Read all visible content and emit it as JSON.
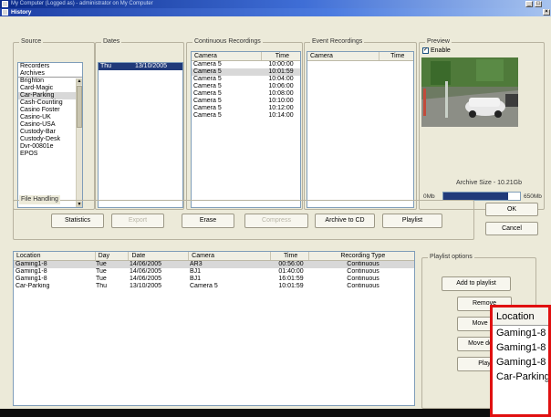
{
  "window": {
    "outer_title": "My Computer (Logged as) - administrator on My Computer",
    "title": "History",
    "controls": [
      "_",
      "□",
      "×"
    ]
  },
  "source": {
    "label": "Source",
    "top_items": [
      "Recorders",
      "Archives"
    ],
    "items": [
      "Brighton",
      "Card-Magic",
      "Car-Parking",
      "Cash-Counting",
      "Casino Foster",
      "Casino-UK",
      "Casino-USA",
      "Custody-Bar",
      "Custody-Desk",
      "Dvr-00801e",
      "EPOS"
    ],
    "selected": "Car-Parking"
  },
  "dates": {
    "label": "Dates",
    "rows": [
      {
        "day": "Thu",
        "date": "13/10/2005"
      }
    ]
  },
  "continuous": {
    "label": "Continuous Recordings",
    "columns": [
      "Camera",
      "Time"
    ],
    "rows": [
      {
        "camera": "Camera 5",
        "time": "10:00:00"
      },
      {
        "camera": "Camera 5",
        "time": "10:01:59"
      },
      {
        "camera": "Camera 5",
        "time": "10:04:00"
      },
      {
        "camera": "Camera 5",
        "time": "10:06:00"
      },
      {
        "camera": "Camera 5",
        "time": "10:08:00"
      },
      {
        "camera": "Camera 5",
        "time": "10:10:00"
      },
      {
        "camera": "Camera 5",
        "time": "10:12:00"
      },
      {
        "camera": "Camera 5",
        "time": "10:14:00"
      }
    ]
  },
  "event": {
    "label": "Event Recordings",
    "columns": [
      "Camera",
      "Time"
    ]
  },
  "preview": {
    "label": "Preview",
    "enable_label": "Enable",
    "enabled": true,
    "archive_size": "Archive Size - 10.21Gb",
    "min_label": "0Mb",
    "max_label": "650Mb",
    "fill_percent": 85
  },
  "file_handling": {
    "label": "File Handling",
    "buttons": [
      {
        "label": "Statistics",
        "enabled": true
      },
      {
        "label": "Export",
        "enabled": false
      },
      {
        "label": "Erase",
        "enabled": true
      },
      {
        "label": "Compress",
        "enabled": false
      },
      {
        "label": "Archive to CD",
        "enabled": true
      },
      {
        "label": "Playlist",
        "enabled": true
      }
    ]
  },
  "dialog": {
    "ok": "OK",
    "cancel": "Cancel"
  },
  "playlist_table": {
    "columns": [
      "Location",
      "Day",
      "Date",
      "Camera",
      "Time",
      "Recording Type"
    ],
    "rows": [
      {
        "location": "Gaming1-8",
        "day": "Tue",
        "date": "14/06/2005",
        "camera": "AR3",
        "time": "00:56:00",
        "type": "Continuous"
      },
      {
        "location": "Gaming1-8",
        "day": "Tue",
        "date": "14/06/2005",
        "camera": "BJ1",
        "time": "01:40:00",
        "type": "Continuous"
      },
      {
        "location": "Gaming1-8",
        "day": "Tue",
        "date": "14/06/2005",
        "camera": "BJ1",
        "time": "16:01:59",
        "type": "Continuous"
      },
      {
        "location": "Car-Parking",
        "day": "Thu",
        "date": "13/10/2005",
        "camera": "Camera 5",
        "time": "10:01:59",
        "type": "Continuous"
      }
    ]
  },
  "playlist_options": {
    "label": "Playlist options",
    "buttons": [
      "Add to playlist",
      "Remove",
      "Move up",
      "Move down",
      "Play"
    ]
  },
  "zoom": {
    "header": "Location",
    "rows": [
      "Gaming1-8",
      "Gaming1-8",
      "Gaming1-8",
      "Car-Parking"
    ]
  },
  "colors": {
    "accent_dark_blue": "#213a7a",
    "window_bg": "#ecead9",
    "callout_red": "#e01010"
  }
}
